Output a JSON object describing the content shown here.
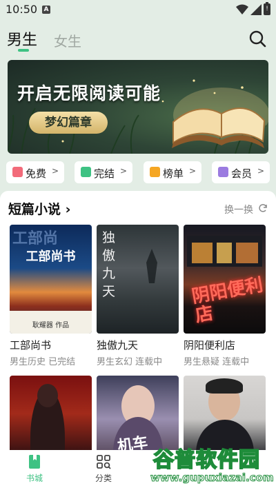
{
  "status": {
    "time": "10:50",
    "badge": "A"
  },
  "tabs": {
    "active": "男生",
    "inactive": "女生"
  },
  "banner": {
    "title": "开启无限阅读可能",
    "tag": "梦幻篇章"
  },
  "quick_entries": [
    {
      "label": "免费",
      "color": "#f26b7a"
    },
    {
      "label": "完结",
      "color": "#3ec283"
    },
    {
      "label": "榜单",
      "color": "#f5a623"
    },
    {
      "label": "会员",
      "color": "#9b7be0"
    }
  ],
  "section": {
    "title": "短篇小说",
    "more": "›",
    "refresh": "换一换"
  },
  "books": [
    {
      "name": "工部尚书",
      "meta": "男生历史 已完结",
      "cover_title": "工部尚书",
      "cover_bg": "工部尚",
      "cover_author": "耿耀器 作品"
    },
    {
      "name": "独傲九天",
      "meta": "男生玄幻 连载中",
      "cover_title": "独傲九天"
    },
    {
      "name": "阴阳便利店",
      "meta": "男生悬疑 连载中",
      "cover_title": "阴阳便利店"
    },
    {
      "name": "",
      "meta": ""
    },
    {
      "name": "",
      "meta": "",
      "cover_title": "机车"
    },
    {
      "name": "",
      "meta": ""
    }
  ],
  "nav": {
    "home": "书城",
    "category": "分类"
  },
  "watermark": {
    "cn": "谷普软件园",
    "url": "www.gupuxiazai.com"
  },
  "colors": {
    "accent": "#3ec283",
    "background": "#e3ede5"
  }
}
